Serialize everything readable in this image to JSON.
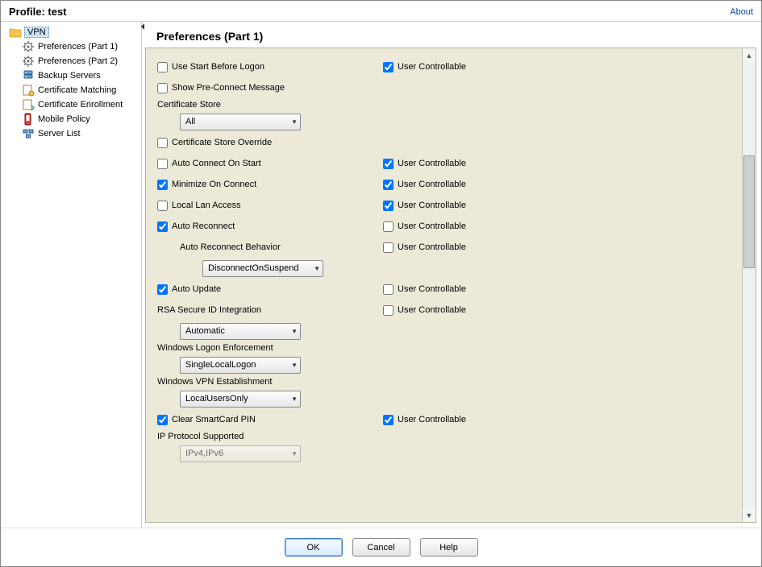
{
  "header": {
    "title": "Profile:  test",
    "about": "About"
  },
  "sidebar": {
    "root": "VPN",
    "items": [
      "Preferences (Part 1)",
      "Preferences (Part 2)",
      "Backup Servers",
      "Certificate Matching",
      "Certificate Enrollment",
      "Mobile Policy",
      "Server List"
    ]
  },
  "content": {
    "title": "Preferences (Part 1)",
    "user_controllable_label": "User Controllable",
    "rows": {
      "use_start_before_logon": {
        "label": "Use Start Before Logon",
        "checked": false,
        "uc_checked": true
      },
      "show_preconnect": {
        "label": "Show Pre-Connect Message",
        "checked": false
      },
      "cert_store_label": "Certificate Store",
      "cert_store_value": "All",
      "cert_store_override": {
        "label": "Certificate Store Override",
        "checked": false
      },
      "auto_connect": {
        "label": "Auto Connect On Start",
        "checked": false,
        "uc_checked": true
      },
      "minimize": {
        "label": "Minimize On Connect",
        "checked": true,
        "uc_checked": true
      },
      "local_lan": {
        "label": "Local Lan Access",
        "checked": false,
        "uc_checked": true
      },
      "auto_reconnect": {
        "label": "Auto Reconnect",
        "checked": true,
        "uc_checked": false
      },
      "auto_reconnect_behavior_label": "Auto Reconnect Behavior",
      "auto_reconnect_behavior_uc_checked": false,
      "auto_reconnect_behavior_value": "DisconnectOnSuspend",
      "auto_update": {
        "label": "Auto Update",
        "checked": true,
        "uc_checked": false
      },
      "rsa_label": "RSA Secure ID Integration",
      "rsa_uc_checked": false,
      "rsa_value": "Automatic",
      "win_logon_label": "Windows Logon Enforcement",
      "win_logon_value": "SingleLocalLogon",
      "win_vpn_label": "Windows VPN Establishment",
      "win_vpn_value": "LocalUsersOnly",
      "clear_smartcard": {
        "label": "Clear SmartCard PIN",
        "checked": true,
        "uc_checked": true
      },
      "ip_proto_label": "IP Protocol Supported",
      "ip_proto_value": "IPv4,IPv6"
    }
  },
  "footer": {
    "ok": "OK",
    "cancel": "Cancel",
    "help": "Help"
  }
}
